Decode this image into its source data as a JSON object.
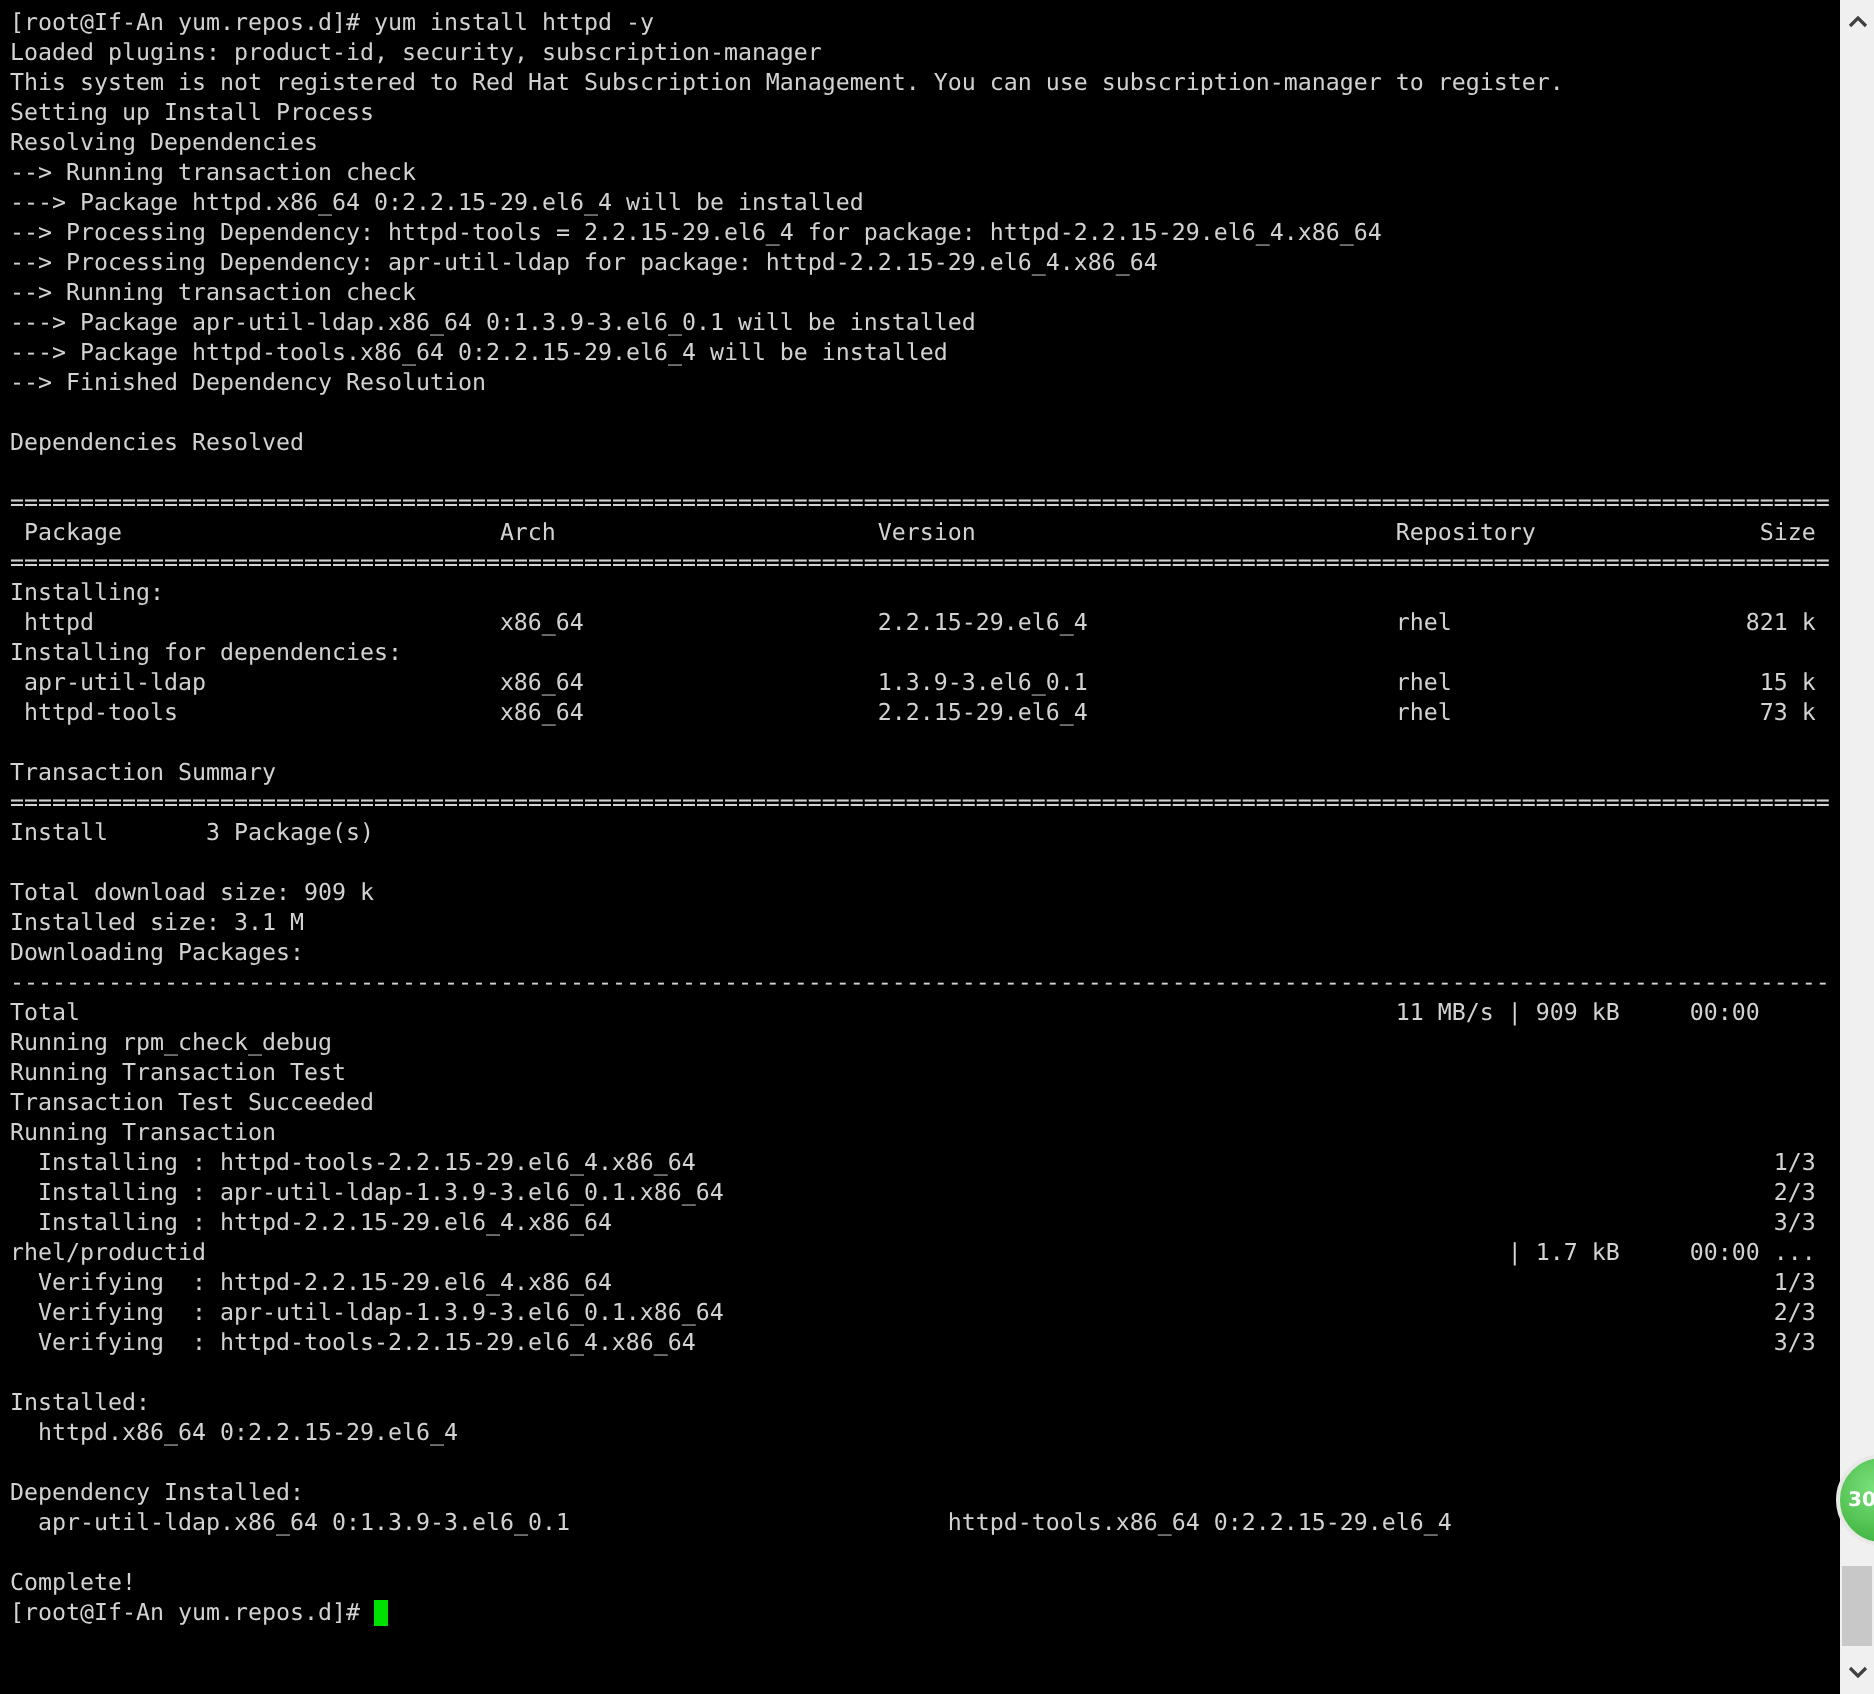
{
  "terminal": {
    "lines": [
      {
        "kind": "command",
        "prompt": "[root@If-An yum.repos.d]#",
        "command": "yum install httpd -y"
      },
      {
        "kind": "text",
        "text": "Loaded plugins: product-id, security, subscription-manager"
      },
      {
        "kind": "text",
        "text": "This system is not registered to Red Hat Subscription Management. You can use subscription-manager to register."
      },
      {
        "kind": "text",
        "text": "Setting up Install Process"
      },
      {
        "kind": "text",
        "text": "Resolving Dependencies"
      },
      {
        "kind": "text",
        "text": "--> Running transaction check"
      },
      {
        "kind": "text",
        "text": "---> Package httpd.x86_64 0:2.2.15-29.el6_4 will be installed"
      },
      {
        "kind": "text",
        "text": "--> Processing Dependency: httpd-tools = 2.2.15-29.el6_4 for package: httpd-2.2.15-29.el6_4.x86_64"
      },
      {
        "kind": "text",
        "text": "--> Processing Dependency: apr-util-ldap for package: httpd-2.2.15-29.el6_4.x86_64"
      },
      {
        "kind": "text",
        "text": "--> Running transaction check"
      },
      {
        "kind": "text",
        "text": "---> Package apr-util-ldap.x86_64 0:1.3.9-3.el6_0.1 will be installed"
      },
      {
        "kind": "text",
        "text": "---> Package httpd-tools.x86_64 0:2.2.15-29.el6_4 will be installed"
      },
      {
        "kind": "text",
        "text": "--> Finished Dependency Resolution"
      },
      {
        "kind": "blank"
      },
      {
        "kind": "text",
        "text": "Dependencies Resolved"
      },
      {
        "kind": "blank"
      },
      {
        "kind": "rule",
        "text": "=================================================================================================================================="
      },
      {
        "kind": "table_row",
        "cells": [
          "Package",
          "Arch",
          "Version",
          "Repository",
          "Size"
        ]
      },
      {
        "kind": "rule",
        "text": "=================================================================================================================================="
      },
      {
        "kind": "text",
        "text": "Installing:"
      },
      {
        "kind": "table_row",
        "cells": [
          "httpd",
          "x86_64",
          "2.2.15-29.el6_4",
          "rhel",
          "821 k"
        ]
      },
      {
        "kind": "text",
        "text": "Installing for dependencies:"
      },
      {
        "kind": "table_row",
        "cells": [
          "apr-util-ldap",
          "x86_64",
          "1.3.9-3.el6_0.1",
          "rhel",
          "15 k"
        ]
      },
      {
        "kind": "table_row",
        "cells": [
          "httpd-tools",
          "x86_64",
          "2.2.15-29.el6_4",
          "rhel",
          "73 k"
        ]
      },
      {
        "kind": "blank"
      },
      {
        "kind": "text",
        "text": "Transaction Summary"
      },
      {
        "kind": "rule",
        "text": "=================================================================================================================================="
      },
      {
        "kind": "summary",
        "label": "Install",
        "value": "3 Package(s)"
      },
      {
        "kind": "blank"
      },
      {
        "kind": "text",
        "text": "Total download size: 909 k"
      },
      {
        "kind": "text",
        "text": "Installed size: 3.1 M"
      },
      {
        "kind": "text",
        "text": "Downloading Packages:"
      },
      {
        "kind": "rule",
        "text": "----------------------------------------------------------------------------------------------------------------------------------"
      },
      {
        "kind": "transfer",
        "name": "Total",
        "stat": "11 MB/s | 909 kB",
        "time": "00:00"
      },
      {
        "kind": "text",
        "text": "Running rpm_check_debug"
      },
      {
        "kind": "text",
        "text": "Running Transaction Test"
      },
      {
        "kind": "text",
        "text": "Transaction Test Succeeded"
      },
      {
        "kind": "text",
        "text": "Running Transaction"
      },
      {
        "kind": "step",
        "text": "Installing : httpd-tools-2.2.15-29.el6_4.x86_64",
        "count": "1/3"
      },
      {
        "kind": "step",
        "text": "Installing : apr-util-ldap-1.3.9-3.el6_0.1.x86_64",
        "count": "2/3"
      },
      {
        "kind": "step",
        "text": "Installing : httpd-2.2.15-29.el6_4.x86_64",
        "count": "3/3"
      },
      {
        "kind": "transfer",
        "name": "rhel/productid",
        "stat": "| 1.7 kB",
        "time": "00:00 ..."
      },
      {
        "kind": "step",
        "text": "Verifying  : httpd-2.2.15-29.el6_4.x86_64",
        "count": "1/3"
      },
      {
        "kind": "step",
        "text": "Verifying  : apr-util-ldap-1.3.9-3.el6_0.1.x86_64",
        "count": "2/3"
      },
      {
        "kind": "step",
        "text": "Verifying  : httpd-tools-2.2.15-29.el6_4.x86_64",
        "count": "3/3"
      },
      {
        "kind": "blank"
      },
      {
        "kind": "text",
        "text": "Installed:"
      },
      {
        "kind": "item",
        "text": "httpd.x86_64 0:2.2.15-29.el6_4"
      },
      {
        "kind": "blank"
      },
      {
        "kind": "text",
        "text": "Dependency Installed:"
      },
      {
        "kind": "pair",
        "cells": [
          "apr-util-ldap.x86_64 0:1.3.9-3.el6_0.1",
          "httpd-tools.x86_64 0:2.2.15-29.el6_4"
        ]
      },
      {
        "kind": "blank"
      },
      {
        "kind": "text",
        "text": "Complete!"
      },
      {
        "kind": "prompt",
        "prompt": "[root@If-An yum.repos.d]#",
        "cursor": true
      }
    ]
  },
  "badge": {
    "text": "30"
  }
}
